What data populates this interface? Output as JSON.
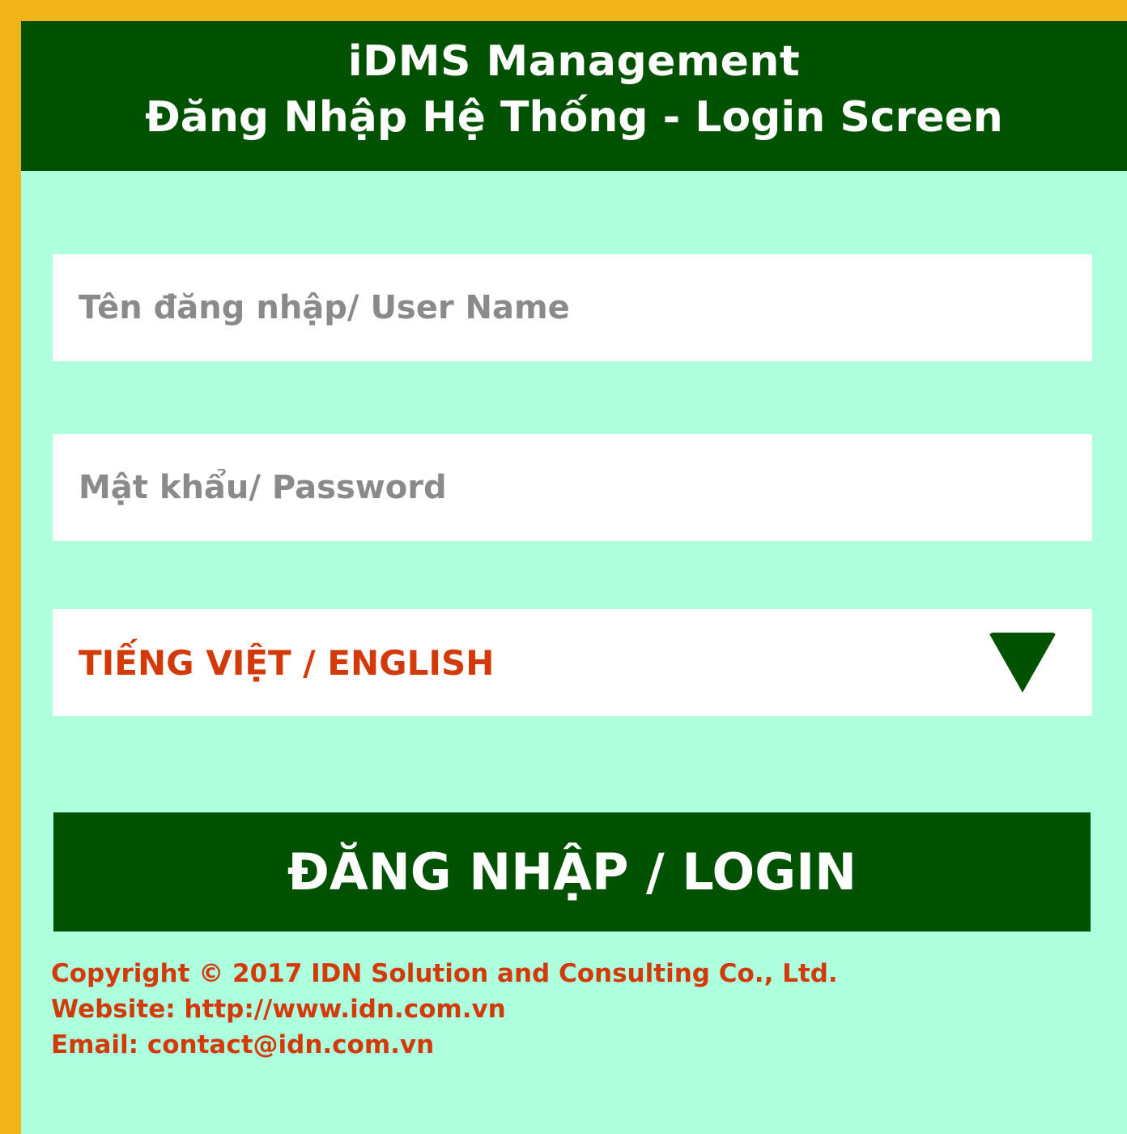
{
  "header": {
    "title": "iDMS Management",
    "subtitle": "Đăng Nhập Hệ Thống - Login Screen"
  },
  "form": {
    "username_placeholder": "Tên đăng nhập/ User Name",
    "username_value": "",
    "password_placeholder": "Mật khẩu/ Password",
    "password_value": "",
    "language_label": "TIẾNG VIỆT / ENGLISH",
    "language_icon": "triangle-down-icon",
    "login_label": "ĐĂNG NHẬP / LOGIN"
  },
  "footer": {
    "copyright": "Copyright © 2017 IDN Solution and Consulting Co., Ltd.",
    "website": "Website: http://www.idn.com.vn",
    "email": "Email: contact@idn.com.vn"
  },
  "colors": {
    "header_bg": "#005200",
    "page_bg": "#aeffdd",
    "frame": "#f0b418",
    "accent_text": "#d33a0a",
    "placeholder": "#8a8a8a"
  }
}
